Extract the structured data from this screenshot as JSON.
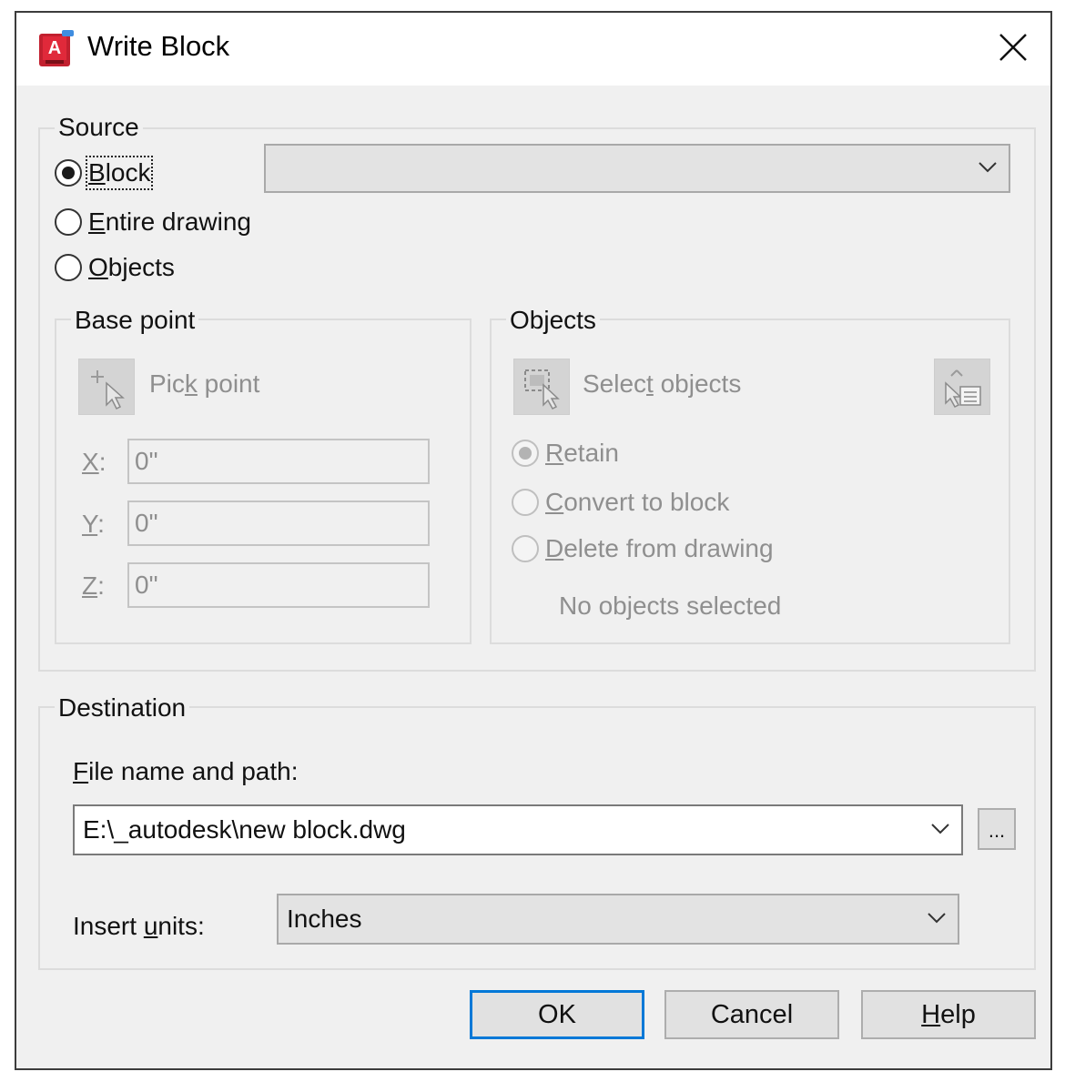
{
  "window": {
    "title": "Write Block",
    "app_icon": "autocad-icon",
    "close_icon": "close-icon"
  },
  "source": {
    "legend": "Source",
    "options": [
      {
        "label": "Block",
        "mnemonic": "B",
        "rest": "lock",
        "checked": true
      },
      {
        "label": "Entire drawing",
        "mnemonic": "E",
        "rest": "ntire drawing",
        "checked": false
      },
      {
        "label": "Objects",
        "mnemonic": "O",
        "rest": "bjects",
        "checked": false
      }
    ],
    "block_select": {
      "value": ""
    }
  },
  "base_point": {
    "legend": "Base point",
    "pick_label_pre": "Pic",
    "pick_label_mn": "k",
    "pick_label_post": " point",
    "x_label": "X:",
    "x_mn": "X",
    "x_value": "0\"",
    "y_label": "Y:",
    "y_mn": "Y",
    "y_value": "0\"",
    "z_label": "Z:",
    "z_mn": "Z",
    "z_value": "0\""
  },
  "objects": {
    "legend": "Objects",
    "select_pre": "Selec",
    "select_mn": "t",
    "select_post": " objects",
    "options": [
      {
        "mn": "R",
        "rest": "etain",
        "checked": true
      },
      {
        "mn": "C",
        "rest": "onvert to block",
        "checked": false
      },
      {
        "mn": "D",
        "rest": "elete from drawing",
        "checked": false
      }
    ],
    "status": "No objects selected"
  },
  "destination": {
    "legend": "Destination",
    "file_label_mn": "F",
    "file_label_rest": "ile name and path:",
    "file_value": "E:\\_autodesk\\new block.dwg",
    "browse_label": "...",
    "units_label_pre": "Insert ",
    "units_label_mn": "u",
    "units_label_post": "nits:",
    "units_value": "Inches"
  },
  "buttons": {
    "ok": "OK",
    "cancel": "Cancel",
    "help_mn": "H",
    "help_rest": "elp"
  },
  "colors": {
    "focus_border": "#0078d7",
    "dialog_bg": "#f0f0f0",
    "disabled_text": "#8f8f8f"
  }
}
